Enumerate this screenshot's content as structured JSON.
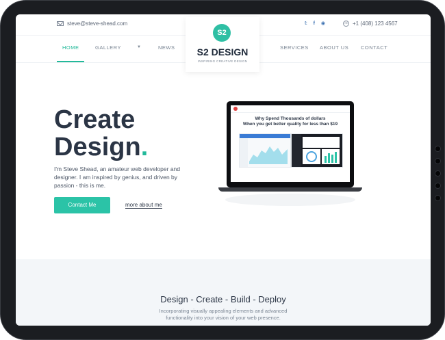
{
  "topbar": {
    "email": "steve@steve-shead.com",
    "phone": "+1 (408) 123 4567",
    "social_icons": [
      "twitter-icon",
      "facebook-icon",
      "globe-icon"
    ],
    "social_glyphs": [
      "𝕥",
      "f",
      "◉"
    ]
  },
  "nav": {
    "items": [
      "HOME",
      "GALLERY",
      "NEWS",
      "SERVICES",
      "ABOUT US",
      "CONTACT"
    ],
    "active": "HOME"
  },
  "logo": {
    "badge": "S2",
    "name": "S2 DESIGN",
    "tagline": "INSPIRING CREATIVE DESIGN"
  },
  "hero": {
    "title_line1": "Create",
    "title_line2": "Design",
    "title_dot": ".",
    "description": "I'm Steve Shead, an amateur web developer and designer. I am inspired by genius, and driven by passion - this is me.",
    "primary_button": "Contact Me",
    "secondary_link": "more about me"
  },
  "laptop_preview": {
    "heading_line1": "Why Spend Thousands of dollars",
    "heading_line2": "When you get better quality for less than $19"
  },
  "band": {
    "title": "Design - Create - Build - Deploy",
    "description": "Incorporating visually appealing elements and advanced functionality into your vision of your web presence."
  },
  "colors": {
    "accent": "#23b99a",
    "text_dark": "#2b3545",
    "device_frame": "#1b1d21"
  }
}
